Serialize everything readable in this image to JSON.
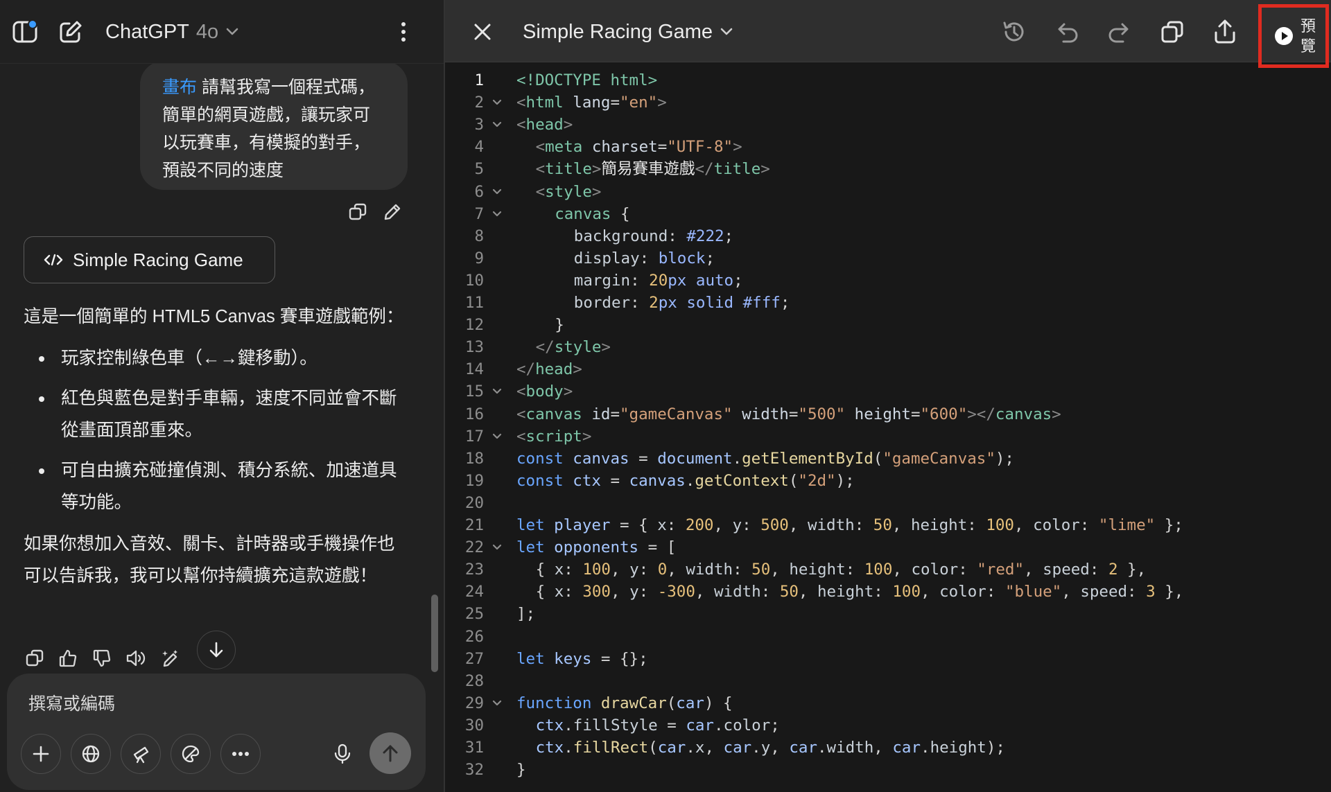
{
  "chat": {
    "model_name": "ChatGPT",
    "model_version": "4o",
    "user_message": {
      "canvas_tag": "畫布",
      "text_lines": [
        " 請幫我寫一個程式碼，",
        "簡單的網頁遊戲，讓玩家可",
        "以玩賽車，有模擬的對手，",
        "預設不同的速度"
      ]
    },
    "canvas_card_label": "Simple Racing Game",
    "assistant": {
      "intro": "這是一個簡單的 HTML5 Canvas 賽車遊戲範例：",
      "bullets": [
        "玩家控制綠色車（←→鍵移動）。",
        "紅色與藍色是對手車輛，速度不同並會不斷從畫面頂部重來。",
        "可自由擴充碰撞偵測、積分系統、加速道具等功能。"
      ],
      "outro": "如果你想加入音效、關卡、計時器或手機操作也可以告訴我，我可以幫你持續擴充這款遊戲！"
    },
    "composer_placeholder": "撰寫或編碼"
  },
  "canvas": {
    "title": "Simple Racing Game",
    "preview_label": "預覽",
    "code_lines": [
      {
        "n": 1,
        "fold": false,
        "indent": 0,
        "tokens": [
          [
            "doc",
            "<!DOCTYPE html>"
          ]
        ]
      },
      {
        "n": 2,
        "fold": true,
        "indent": 0,
        "tokens": [
          [
            "ang",
            "<"
          ],
          [
            "tag",
            "html"
          ],
          [
            "attr",
            " lang"
          ],
          [
            "pun",
            "="
          ],
          [
            "str",
            "\"en\""
          ],
          [
            "ang",
            ">"
          ]
        ]
      },
      {
        "n": 3,
        "fold": true,
        "indent": 0,
        "tokens": [
          [
            "ang",
            "<"
          ],
          [
            "tag",
            "head"
          ],
          [
            "ang",
            ">"
          ]
        ]
      },
      {
        "n": 4,
        "fold": false,
        "indent": 1,
        "tokens": [
          [
            "ang",
            "<"
          ],
          [
            "tag",
            "meta"
          ],
          [
            "attr",
            " charset"
          ],
          [
            "pun",
            "="
          ],
          [
            "str",
            "\"UTF-8\""
          ],
          [
            "ang",
            ">"
          ]
        ]
      },
      {
        "n": 5,
        "fold": false,
        "indent": 1,
        "tokens": [
          [
            "ang",
            "<"
          ],
          [
            "tag",
            "title"
          ],
          [
            "ang",
            ">"
          ],
          [
            "txt",
            "簡易賽車遊戲"
          ],
          [
            "ang",
            "</"
          ],
          [
            "tag",
            "title"
          ],
          [
            "ang",
            ">"
          ]
        ]
      },
      {
        "n": 6,
        "fold": true,
        "indent": 1,
        "tokens": [
          [
            "ang",
            "<"
          ],
          [
            "tag",
            "style"
          ],
          [
            "ang",
            ">"
          ]
        ]
      },
      {
        "n": 7,
        "fold": true,
        "indent": 2,
        "tokens": [
          [
            "tag",
            "canvas"
          ],
          [
            "pun",
            " {"
          ]
        ]
      },
      {
        "n": 8,
        "fold": false,
        "indent": 3,
        "tokens": [
          [
            "prop",
            "background"
          ],
          [
            "pun",
            ": "
          ],
          [
            "val",
            "#222"
          ],
          [
            "pun",
            ";"
          ]
        ]
      },
      {
        "n": 9,
        "fold": false,
        "indent": 3,
        "tokens": [
          [
            "prop",
            "display"
          ],
          [
            "pun",
            ": "
          ],
          [
            "val",
            "block"
          ],
          [
            "pun",
            ";"
          ]
        ]
      },
      {
        "n": 10,
        "fold": false,
        "indent": 3,
        "tokens": [
          [
            "prop",
            "margin"
          ],
          [
            "pun",
            ": "
          ],
          [
            "num",
            "20"
          ],
          [
            "val",
            "px auto"
          ],
          [
            "pun",
            ";"
          ]
        ]
      },
      {
        "n": 11,
        "fold": false,
        "indent": 3,
        "tokens": [
          [
            "prop",
            "border"
          ],
          [
            "pun",
            ": "
          ],
          [
            "num",
            "2"
          ],
          [
            "val",
            "px solid #fff"
          ],
          [
            "pun",
            ";"
          ]
        ]
      },
      {
        "n": 12,
        "fold": false,
        "indent": 2,
        "tokens": [
          [
            "pun",
            "}"
          ]
        ]
      },
      {
        "n": 13,
        "fold": false,
        "indent": 1,
        "tokens": [
          [
            "ang",
            "</"
          ],
          [
            "tag",
            "style"
          ],
          [
            "ang",
            ">"
          ]
        ]
      },
      {
        "n": 14,
        "fold": false,
        "indent": 0,
        "tokens": [
          [
            "ang",
            "</"
          ],
          [
            "tag",
            "head"
          ],
          [
            "ang",
            ">"
          ]
        ]
      },
      {
        "n": 15,
        "fold": true,
        "indent": 0,
        "tokens": [
          [
            "ang",
            "<"
          ],
          [
            "tag",
            "body"
          ],
          [
            "ang",
            ">"
          ]
        ]
      },
      {
        "n": 16,
        "fold": false,
        "indent": 0,
        "tokens": [
          [
            "ang",
            "<"
          ],
          [
            "tag",
            "canvas"
          ],
          [
            "attr",
            " id"
          ],
          [
            "pun",
            "="
          ],
          [
            "str",
            "\"gameCanvas\""
          ],
          [
            "attr",
            " width"
          ],
          [
            "pun",
            "="
          ],
          [
            "str",
            "\"500\""
          ],
          [
            "attr",
            " height"
          ],
          [
            "pun",
            "="
          ],
          [
            "str",
            "\"600\""
          ],
          [
            "ang",
            "></"
          ],
          [
            "tag",
            "canvas"
          ],
          [
            "ang",
            ">"
          ]
        ]
      },
      {
        "n": 17,
        "fold": true,
        "indent": 0,
        "tokens": [
          [
            "ang",
            "<"
          ],
          [
            "tag",
            "script"
          ],
          [
            "ang",
            ">"
          ]
        ]
      },
      {
        "n": 18,
        "fold": false,
        "indent": 0,
        "tokens": [
          [
            "kw",
            "const"
          ],
          [
            "var",
            " canvas"
          ],
          [
            "pun",
            " = "
          ],
          [
            "var",
            "document"
          ],
          [
            "pun",
            "."
          ],
          [
            "fn",
            "getElementById"
          ],
          [
            "pun",
            "("
          ],
          [
            "str",
            "\"gameCanvas\""
          ],
          [
            "pun",
            ");"
          ]
        ]
      },
      {
        "n": 19,
        "fold": false,
        "indent": 0,
        "tokens": [
          [
            "kw",
            "const"
          ],
          [
            "var",
            " ctx"
          ],
          [
            "pun",
            " = "
          ],
          [
            "var",
            "canvas"
          ],
          [
            "pun",
            "."
          ],
          [
            "fn",
            "getContext"
          ],
          [
            "pun",
            "("
          ],
          [
            "str",
            "\"2d\""
          ],
          [
            "pun",
            ");"
          ]
        ]
      },
      {
        "n": 20,
        "fold": false,
        "indent": 0,
        "tokens": []
      },
      {
        "n": 21,
        "fold": false,
        "indent": 0,
        "tokens": [
          [
            "kw",
            "let"
          ],
          [
            "var",
            " player"
          ],
          [
            "pun",
            " = { "
          ],
          [
            "prop",
            "x"
          ],
          [
            "pun",
            ": "
          ],
          [
            "num",
            "200"
          ],
          [
            "pun",
            ", "
          ],
          [
            "prop",
            "y"
          ],
          [
            "pun",
            ": "
          ],
          [
            "num",
            "500"
          ],
          [
            "pun",
            ", "
          ],
          [
            "prop",
            "width"
          ],
          [
            "pun",
            ": "
          ],
          [
            "num",
            "50"
          ],
          [
            "pun",
            ", "
          ],
          [
            "prop",
            "height"
          ],
          [
            "pun",
            ": "
          ],
          [
            "num",
            "100"
          ],
          [
            "pun",
            ", "
          ],
          [
            "prop",
            "color"
          ],
          [
            "pun",
            ": "
          ],
          [
            "str",
            "\"lime\""
          ],
          [
            "pun",
            " };"
          ]
        ]
      },
      {
        "n": 22,
        "fold": true,
        "indent": 0,
        "tokens": [
          [
            "kw",
            "let"
          ],
          [
            "var",
            " opponents"
          ],
          [
            "pun",
            " = ["
          ]
        ]
      },
      {
        "n": 23,
        "fold": false,
        "indent": 1,
        "tokens": [
          [
            "pun",
            "{ "
          ],
          [
            "prop",
            "x"
          ],
          [
            "pun",
            ": "
          ],
          [
            "num",
            "100"
          ],
          [
            "pun",
            ", "
          ],
          [
            "prop",
            "y"
          ],
          [
            "pun",
            ": "
          ],
          [
            "num",
            "0"
          ],
          [
            "pun",
            ", "
          ],
          [
            "prop",
            "width"
          ],
          [
            "pun",
            ": "
          ],
          [
            "num",
            "50"
          ],
          [
            "pun",
            ", "
          ],
          [
            "prop",
            "height"
          ],
          [
            "pun",
            ": "
          ],
          [
            "num",
            "100"
          ],
          [
            "pun",
            ", "
          ],
          [
            "prop",
            "color"
          ],
          [
            "pun",
            ": "
          ],
          [
            "str",
            "\"red\""
          ],
          [
            "pun",
            ", "
          ],
          [
            "prop",
            "speed"
          ],
          [
            "pun",
            ": "
          ],
          [
            "num",
            "2"
          ],
          [
            "pun",
            " },"
          ]
        ]
      },
      {
        "n": 24,
        "fold": false,
        "indent": 1,
        "tokens": [
          [
            "pun",
            "{ "
          ],
          [
            "prop",
            "x"
          ],
          [
            "pun",
            ": "
          ],
          [
            "num",
            "300"
          ],
          [
            "pun",
            ", "
          ],
          [
            "prop",
            "y"
          ],
          [
            "pun",
            ": "
          ],
          [
            "num",
            "-300"
          ],
          [
            "pun",
            ", "
          ],
          [
            "prop",
            "width"
          ],
          [
            "pun",
            ": "
          ],
          [
            "num",
            "50"
          ],
          [
            "pun",
            ", "
          ],
          [
            "prop",
            "height"
          ],
          [
            "pun",
            ": "
          ],
          [
            "num",
            "100"
          ],
          [
            "pun",
            ", "
          ],
          [
            "prop",
            "color"
          ],
          [
            "pun",
            ": "
          ],
          [
            "str",
            "\"blue\""
          ],
          [
            "pun",
            ", "
          ],
          [
            "prop",
            "speed"
          ],
          [
            "pun",
            ": "
          ],
          [
            "num",
            "3"
          ],
          [
            "pun",
            " },"
          ]
        ]
      },
      {
        "n": 25,
        "fold": false,
        "indent": 0,
        "tokens": [
          [
            "pun",
            "];"
          ]
        ]
      },
      {
        "n": 26,
        "fold": false,
        "indent": 0,
        "tokens": []
      },
      {
        "n": 27,
        "fold": false,
        "indent": 0,
        "tokens": [
          [
            "kw",
            "let"
          ],
          [
            "var",
            " keys"
          ],
          [
            "pun",
            " = {};"
          ]
        ]
      },
      {
        "n": 28,
        "fold": false,
        "indent": 0,
        "tokens": []
      },
      {
        "n": 29,
        "fold": true,
        "indent": 0,
        "tokens": [
          [
            "kw",
            "function"
          ],
          [
            "fn",
            " drawCar"
          ],
          [
            "pun",
            "("
          ],
          [
            "var",
            "car"
          ],
          [
            "pun",
            ") {"
          ]
        ]
      },
      {
        "n": 30,
        "fold": false,
        "indent": 1,
        "tokens": [
          [
            "var",
            "ctx"
          ],
          [
            "pun",
            "."
          ],
          [
            "prop",
            "fillStyle"
          ],
          [
            "pun",
            " = "
          ],
          [
            "var",
            "car"
          ],
          [
            "pun",
            "."
          ],
          [
            "prop",
            "color"
          ],
          [
            "pun",
            ";"
          ]
        ]
      },
      {
        "n": 31,
        "fold": false,
        "indent": 1,
        "tokens": [
          [
            "var",
            "ctx"
          ],
          [
            "pun",
            "."
          ],
          [
            "fn",
            "fillRect"
          ],
          [
            "pun",
            "("
          ],
          [
            "var",
            "car"
          ],
          [
            "pun",
            "."
          ],
          [
            "prop",
            "x"
          ],
          [
            "pun",
            ", "
          ],
          [
            "var",
            "car"
          ],
          [
            "pun",
            "."
          ],
          [
            "prop",
            "y"
          ],
          [
            "pun",
            ", "
          ],
          [
            "var",
            "car"
          ],
          [
            "pun",
            "."
          ],
          [
            "prop",
            "width"
          ],
          [
            "pun",
            ", "
          ],
          [
            "var",
            "car"
          ],
          [
            "pun",
            "."
          ],
          [
            "prop",
            "height"
          ],
          [
            "pun",
            ");"
          ]
        ]
      },
      {
        "n": 32,
        "fold": false,
        "indent": 0,
        "tokens": [
          [
            "pun",
            "}"
          ]
        ]
      }
    ]
  },
  "colors": {
    "accent_blue": "#3a9bff",
    "highlight_red": "#e02b20",
    "chat_bg": "#212121",
    "editor_bg": "#181818"
  },
  "icons": {
    "sidebar": "sidebar-toggle-icon",
    "new_chat": "edit-icon",
    "more": "vertical-dots-icon",
    "close": "close-icon",
    "history": "history-icon",
    "undo": "undo-icon",
    "redo": "redo-icon",
    "copy": "copy-icon",
    "share": "share-icon",
    "preview": "play-icon"
  }
}
